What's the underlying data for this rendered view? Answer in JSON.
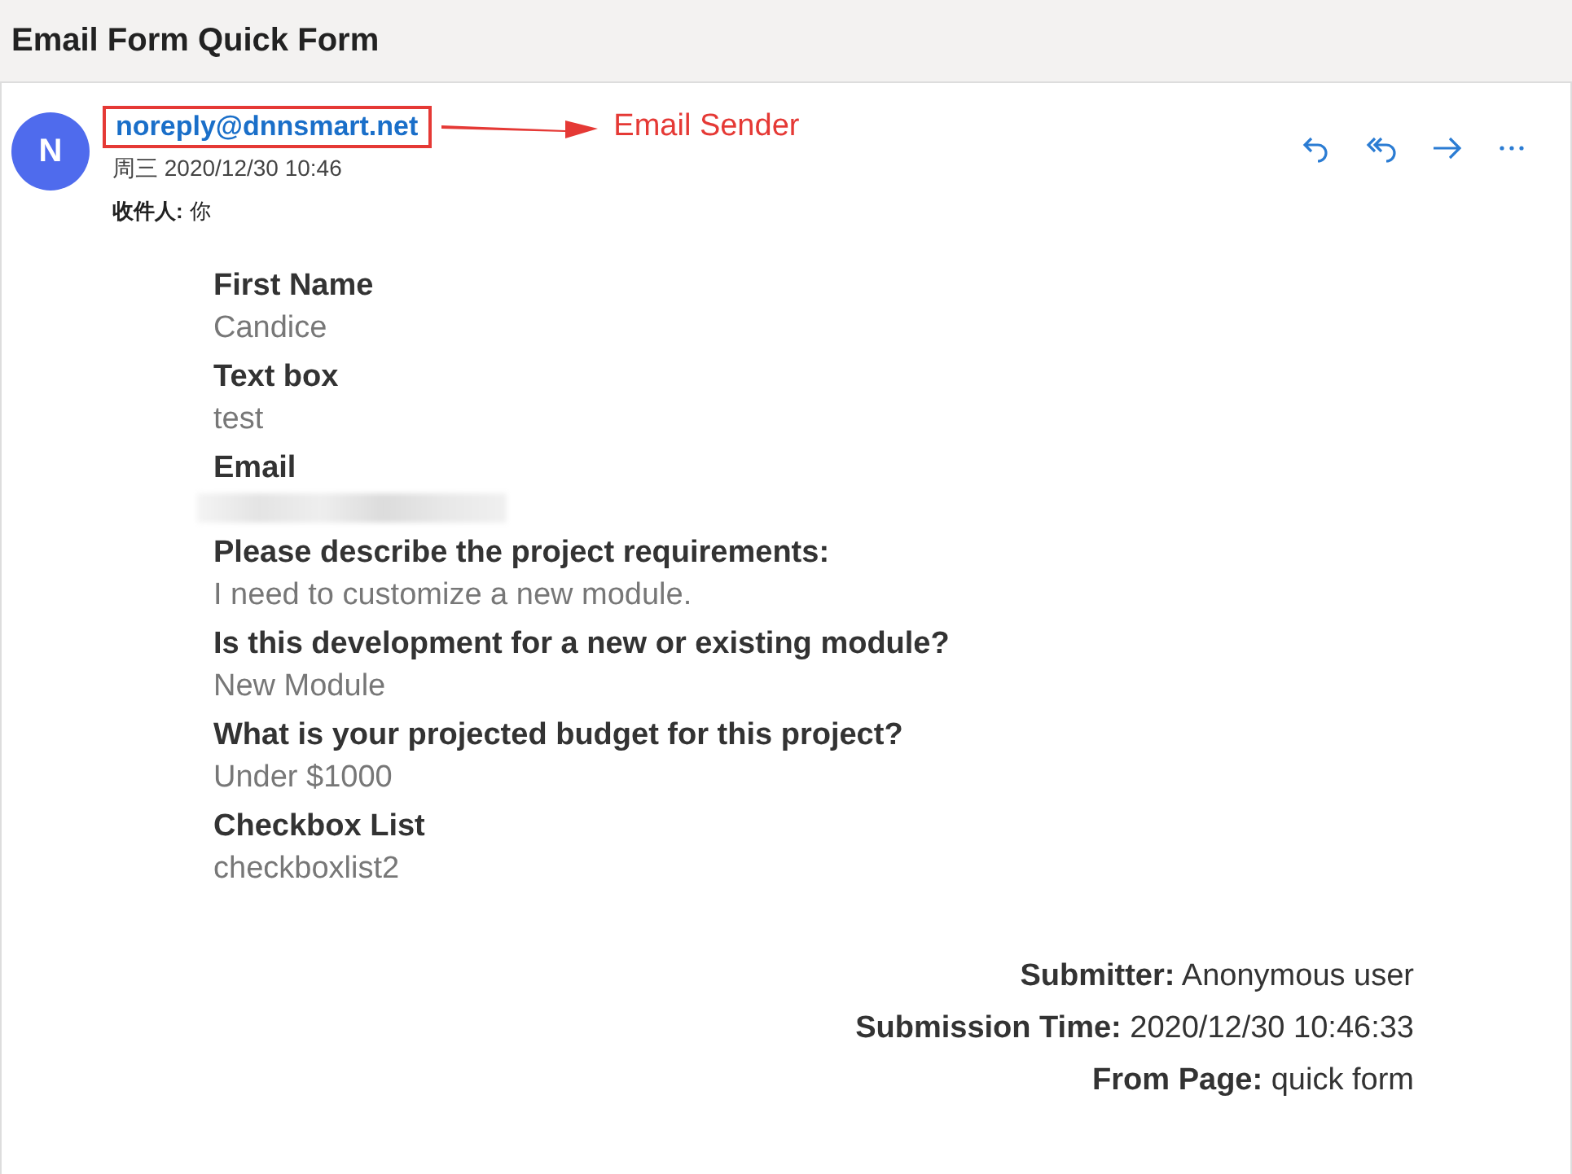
{
  "window": {
    "title": "Email Form Quick Form"
  },
  "message": {
    "avatar": "N",
    "sender": "noreply@dnnsmart.net",
    "date": "周三 2020/12/30 10:46",
    "to_label": "收件人:",
    "to": "你",
    "actions": [
      {
        "kind": "reply"
      },
      {
        "kind": "reply-all"
      },
      {
        "kind": "forward"
      },
      {
        "kind": "more"
      }
    ],
    "fields": [
      {
        "kind": "text",
        "label": "First Name",
        "value": "Candice"
      },
      {
        "kind": "text",
        "label": "Text box",
        "value": "test"
      },
      {
        "kind": "redacted",
        "label": "Email"
      },
      {
        "kind": "text",
        "label": "Please describe the project requirements:",
        "value": "I need to customize a new module."
      },
      {
        "kind": "text",
        "label": "Is this development for a new or existing module?",
        "value": "New Module"
      },
      {
        "kind": "text",
        "label": "What is your projected budget for this project?",
        "value": "Under $1000"
      },
      {
        "kind": "text",
        "label": "Checkbox List",
        "value": "checkboxlist2"
      }
    ],
    "footer": [
      {
        "label": "Submitter:",
        "value": "Anonymous user"
      },
      {
        "label": "Submission Time:",
        "value": "2020/12/30 10:46:33"
      },
      {
        "label": "From Page:",
        "value": "quick form"
      }
    ]
  },
  "annotation": {
    "text": "Email Sender"
  }
}
